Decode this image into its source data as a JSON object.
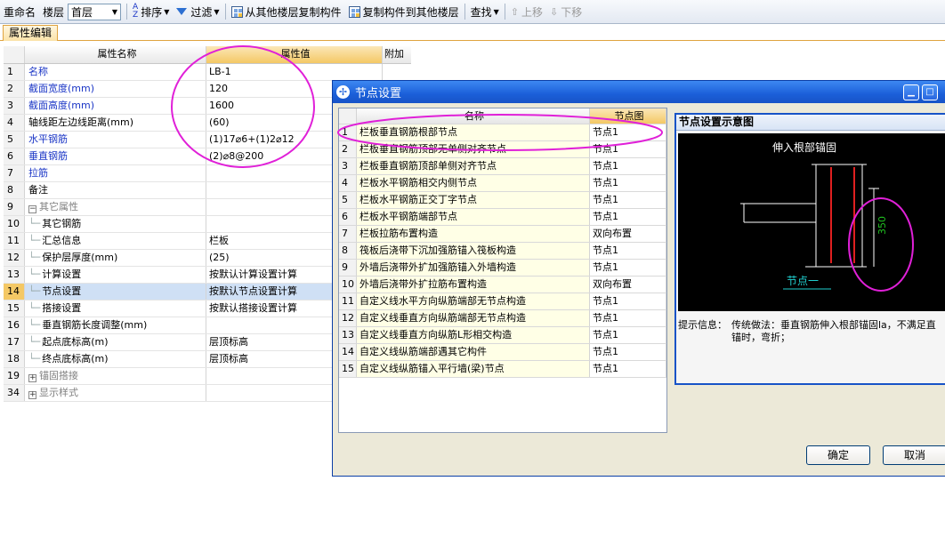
{
  "toolbar": {
    "rename": "重命名",
    "floor_label": "楼层",
    "floor_value": "首层",
    "sort": "排序",
    "filter": "过滤",
    "copy_from": "从其他楼层复制构件",
    "copy_to": "复制构件到其他楼层",
    "find": "查找",
    "move_up": "上移",
    "move_down": "下移"
  },
  "tab": {
    "label": "属性编辑"
  },
  "props": {
    "headers": {
      "name": "属性名称",
      "value": "属性值",
      "extra": "附加"
    },
    "rows": [
      {
        "n": "1",
        "name": "名称",
        "value": "LB-1"
      },
      {
        "n": "2",
        "name": "截面宽度(mm)",
        "value": "120"
      },
      {
        "n": "3",
        "name": "截面高度(mm)",
        "value": "1600"
      },
      {
        "n": "4",
        "name": "轴线距左边线距离(mm)",
        "value": "(60)"
      },
      {
        "n": "5",
        "name": "水平钢筋",
        "value": "(1)17⌀6+(1)2⌀12"
      },
      {
        "n": "6",
        "name": "垂直钢筋",
        "value": "(2)⌀8@200"
      },
      {
        "n": "7",
        "name": "拉筋",
        "value": ""
      },
      {
        "n": "8",
        "name": "备注",
        "value": ""
      },
      {
        "n": "9",
        "name": "其它属性",
        "value": ""
      },
      {
        "n": "10",
        "name": "其它钢筋",
        "value": ""
      },
      {
        "n": "11",
        "name": "汇总信息",
        "value": "栏板"
      },
      {
        "n": "12",
        "name": "保护层厚度(mm)",
        "value": "(25)"
      },
      {
        "n": "13",
        "name": "计算设置",
        "value": "按默认计算设置计算"
      },
      {
        "n": "14",
        "name": "节点设置",
        "value": "按默认节点设置计算"
      },
      {
        "n": "15",
        "name": "搭接设置",
        "value": "按默认搭接设置计算"
      },
      {
        "n": "16",
        "name": "垂直钢筋长度调整(mm)",
        "value": ""
      },
      {
        "n": "17",
        "name": "起点底标高(m)",
        "value": "层顶标高"
      },
      {
        "n": "18",
        "name": "终点底标高(m)",
        "value": "层顶标高"
      },
      {
        "n": "19",
        "name": "锚固搭接",
        "value": ""
      },
      {
        "n": "34",
        "name": "显示样式",
        "value": ""
      }
    ]
  },
  "dialog": {
    "title": "节点设置",
    "headers": {
      "name": "名称",
      "diagram": "节点图"
    },
    "rows": [
      {
        "n": "1",
        "name": "栏板垂直钢筋根部节点",
        "value": "节点1"
      },
      {
        "n": "2",
        "name": "栏板垂直钢筋顶部无单侧对齐节点",
        "value": "节点1"
      },
      {
        "n": "3",
        "name": "栏板垂直钢筋顶部单侧对齐节点",
        "value": "节点1"
      },
      {
        "n": "4",
        "name": "栏板水平钢筋相交内侧节点",
        "value": "节点1"
      },
      {
        "n": "5",
        "name": "栏板水平钢筋正交丁字节点",
        "value": "节点1"
      },
      {
        "n": "6",
        "name": "栏板水平钢筋端部节点",
        "value": "节点1"
      },
      {
        "n": "7",
        "name": "栏板拉筋布置构造",
        "value": "双向布置"
      },
      {
        "n": "8",
        "name": "筏板后浇带下沉加强筋锚入筏板构造",
        "value": "节点1"
      },
      {
        "n": "9",
        "name": "外墙后浇带外扩加强筋锚入外墙构造",
        "value": "节点1"
      },
      {
        "n": "10",
        "name": "外墙后浇带外扩拉筋布置构造",
        "value": "双向布置"
      },
      {
        "n": "11",
        "name": "自定义线水平方向纵筋端部无节点构造",
        "value": "节点1"
      },
      {
        "n": "12",
        "name": "自定义线垂直方向纵筋端部无节点构造",
        "value": "节点1"
      },
      {
        "n": "13",
        "name": "自定义线垂直方向纵筋L形相交构造",
        "value": "节点1"
      },
      {
        "n": "14",
        "name": "自定义线纵筋端部遇其它构件",
        "value": "节点1"
      },
      {
        "n": "15",
        "name": "自定义线纵筋锚入平行墙(梁)节点",
        "value": "节点1"
      }
    ],
    "diagram_title": "节点设置示意图",
    "diagram_caption": "伸入根部锚固",
    "diagram_dimension": "350",
    "diagram_node_label": "节点一",
    "hint_label": "提示信息：",
    "hint_text": "传统做法：垂直钢筋伸入根部锚固la，不满足直锚时，弯折；",
    "ok": "确定",
    "cancel": "取消"
  },
  "colors": {
    "annotation": "#e020d8",
    "rebar": "#e02020",
    "dimension": "#20c020",
    "node_label": "#20d0d0"
  }
}
